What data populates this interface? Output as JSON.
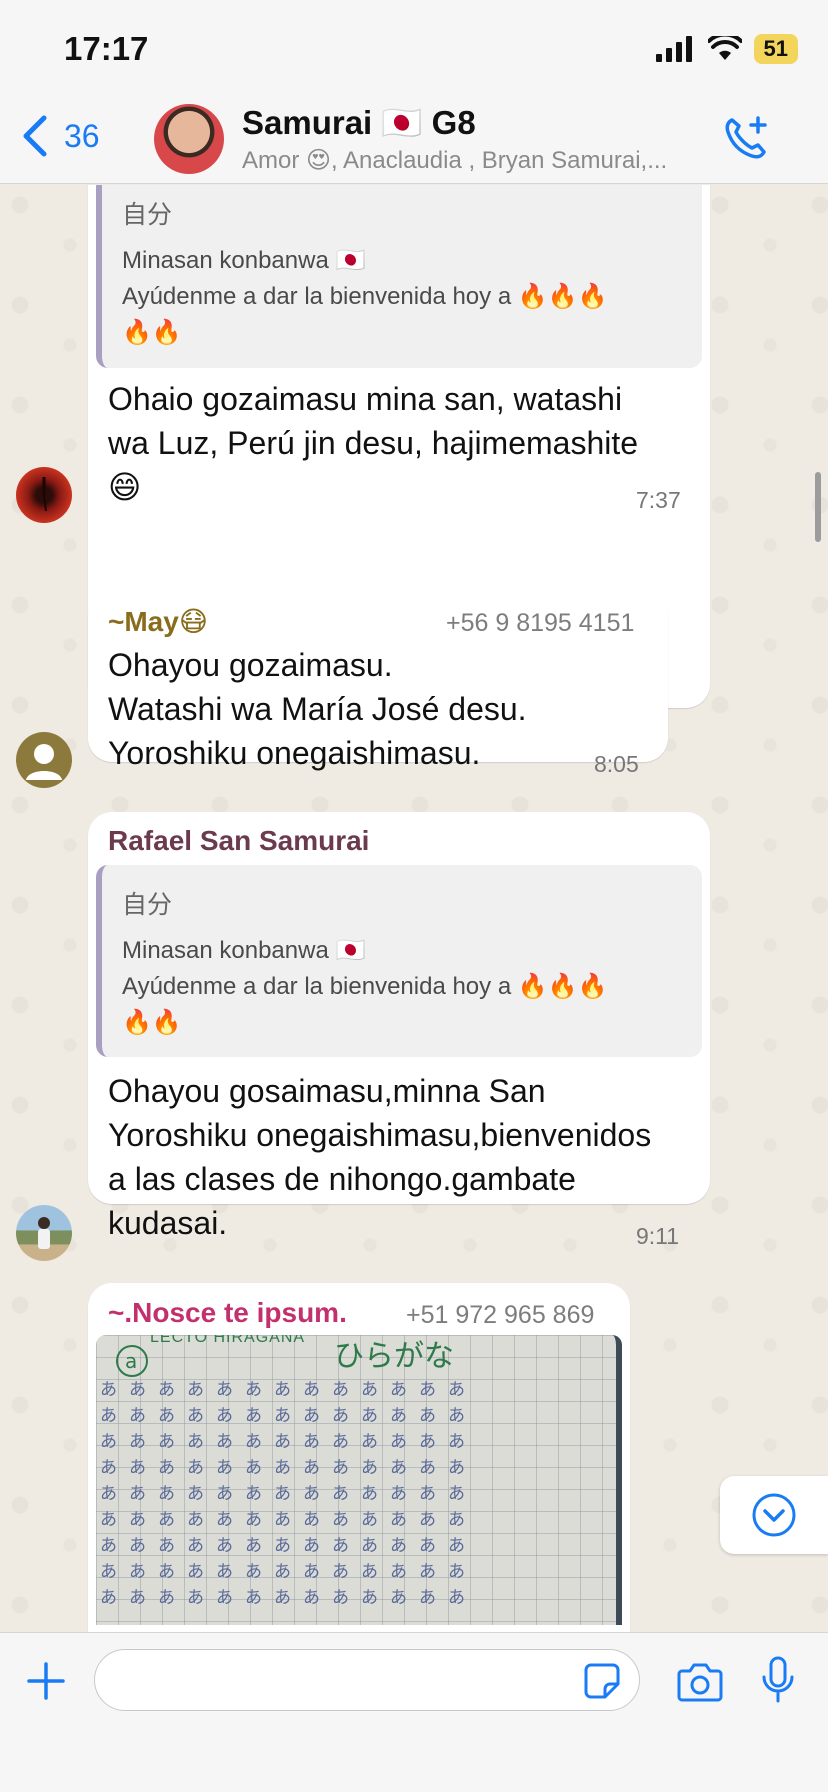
{
  "status_bar": {
    "time": "17:17",
    "battery": "51"
  },
  "header": {
    "back_count": "36",
    "title": "Samurai 🇯🇵 G8",
    "subtitle": "Amor 😍, Anaclaudia , Bryan Samurai,..."
  },
  "messages": [
    {
      "quote_author": "自分",
      "quote_lines": [
        "Minasan konbanwa 🇯🇵",
        "Ayúdenme a dar la bienvenida hoy a 🔥🔥🔥",
        "🔥🔥"
      ],
      "text_lines": [
        "Ohaio gozaimasu mina san, watashi",
        "wa Luz, Perú jin desu, hajimemashite",
        "😄"
      ],
      "time": "7:37",
      "reaction": "👍"
    },
    {
      "sender": "~May😷",
      "phone": "+56 9 8195 4151",
      "text_lines": [
        "Ohayou gozaimasu.",
        "Watashi wa María José desu.",
        "Yoroshiku onegaishimasu."
      ],
      "time": "8:05"
    },
    {
      "sender": "Rafael San Samurai",
      "quote_author": "自分",
      "quote_lines": [
        "Minasan konbanwa 🇯🇵",
        "Ayúdenme a dar la bienvenida hoy a 🔥🔥🔥",
        "🔥🔥"
      ],
      "text_lines": [
        "Ohayou gosaimasu,minna San",
        "Yoroshiku onegaishimasu,bienvenidos",
        "a las clases de nihongo.gambate",
        "kudasai."
      ],
      "time": "9:11"
    },
    {
      "sender": "~.Nosce te ipsum.",
      "phone": "+51 972 965 869",
      "image_heading": "LECTO HIRAGANA",
      "image_kana": "ひらがな"
    }
  ],
  "colors": {
    "accent": "#1a7cf5",
    "sender_may": "#8a6d1c",
    "sender_rafael": "#6b3a4c",
    "sender_nosce": "#c2306e"
  }
}
